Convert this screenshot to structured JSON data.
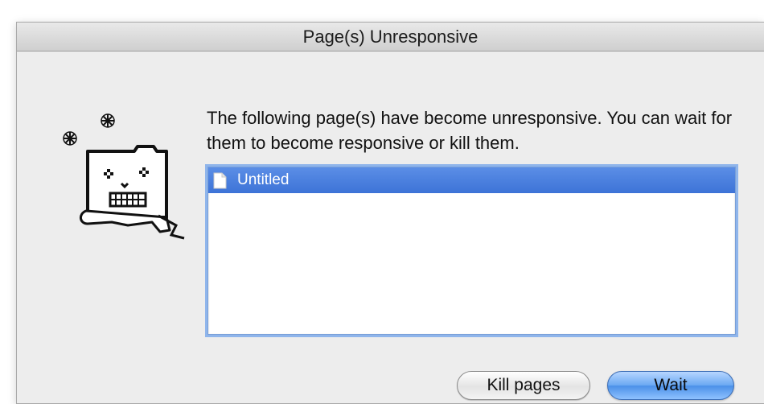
{
  "dialog": {
    "title": "Page(s) Unresponsive",
    "message": "The following page(s) have become unresponsive. You can wait for them to become responsive or kill them."
  },
  "mascot": {
    "icon": "frozen-tab-mascot-icon"
  },
  "page_list": {
    "items": [
      {
        "label": "Untitled",
        "icon": "document-icon",
        "selected": true
      }
    ]
  },
  "buttons": {
    "kill_label": "Kill pages",
    "wait_label": "Wait"
  },
  "colors": {
    "selection": "#3d73d7",
    "default_button": "#6aa8f2",
    "focus_ring": "#8fb5eb"
  }
}
